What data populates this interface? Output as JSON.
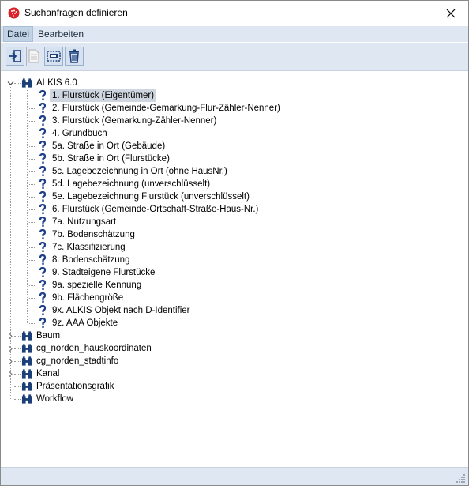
{
  "window": {
    "title": "Suchanfragen definieren"
  },
  "menu": {
    "items": [
      "Datei",
      "Bearbeiten"
    ]
  },
  "toolbar": {
    "buttons": [
      {
        "icon": "exit-icon",
        "enabled": true
      },
      {
        "icon": "document-icon",
        "enabled": false
      },
      {
        "icon": "select-all-icon",
        "enabled": true
      },
      {
        "icon": "trash-icon",
        "enabled": true
      }
    ]
  },
  "tree": {
    "root": {
      "label": "ALKIS 6.0",
      "expanded": true
    },
    "queries": [
      "1. Flurstück (Eigentümer)",
      "2. Flurstück (Gemeinde-Gemarkung-Flur-Zähler-Nenner)",
      "3. Flurstück (Gemarkung-Zähler-Nenner)",
      "4. Grundbuch",
      "5a. Straße in Ort (Gebäude)",
      "5b. Straße in Ort (Flurstücke)",
      "5c. Lagebezeichnung in Ort (ohne HausNr.)",
      "5d. Lagebezeichnung (unverschlüsselt)",
      "5e. Lagebezeichnung Flurstück (unverschlüsselt)",
      "6. Flurstück (Gemeinde-Ortschaft-Straße-Haus-Nr.)",
      "7a. Nutzungsart",
      "7b. Bodenschätzung",
      "7c. Klassifizierung",
      "8. Bodenschätzung",
      "9. Stadteigene Flurstücke",
      "9a. spezielle Kennung",
      "9b. Flächengröße",
      "9x. ALKIS Objekt nach D-Identifier",
      "9z. AAA Objekte"
    ],
    "selected": "1. Flurstück (Eigentümer)",
    "groups": [
      {
        "label": "Baum",
        "expandable": true
      },
      {
        "label": "cg_norden_hauskoordinaten",
        "expandable": true
      },
      {
        "label": "cg_norden_stadtinfo",
        "expandable": true
      },
      {
        "label": "Kanal",
        "expandable": true
      },
      {
        "label": "Präsentationsgrafik",
        "expandable": false
      },
      {
        "label": "Workflow",
        "expandable": false
      }
    ]
  },
  "colors": {
    "accent": "#1c3f7a",
    "query_icon": "#1d3f87",
    "selection": "#cfd6e0",
    "menubar": "#dfe7f2"
  }
}
